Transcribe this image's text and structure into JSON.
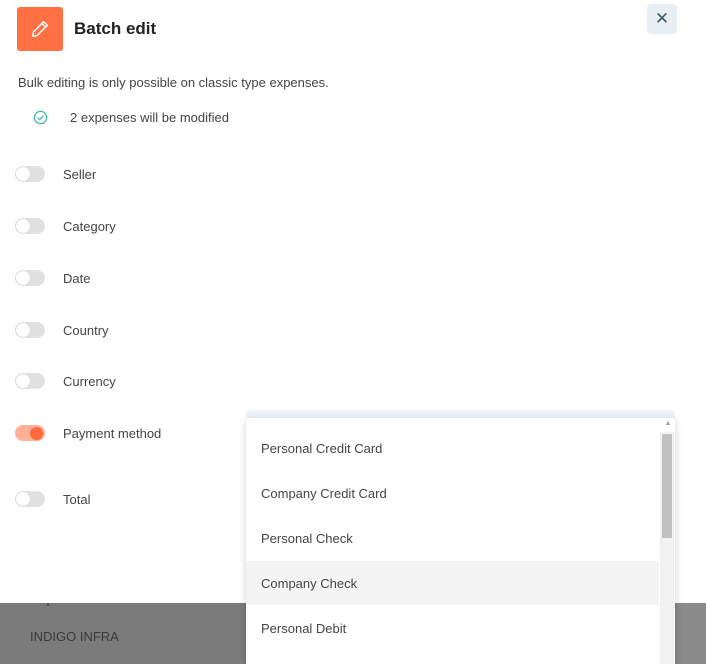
{
  "header": {
    "title": "Batch edit",
    "icon": "pencil-icon",
    "close_icon": "close-icon",
    "close_glyph": "✕"
  },
  "info": {
    "text": "Bulk editing is only possible on classic type expenses.",
    "modified_count_text": "2 expenses will be modified"
  },
  "fields": [
    {
      "label": "Seller",
      "enabled": false
    },
    {
      "label": "Category",
      "enabled": false
    },
    {
      "label": "Date",
      "enabled": false
    },
    {
      "label": "Country",
      "enabled": false
    },
    {
      "label": "Currency",
      "enabled": false
    },
    {
      "label": "Payment method",
      "enabled": true
    },
    {
      "label": "Total",
      "enabled": false
    }
  ],
  "dropdown": {
    "options": [
      "Personal Credit Card",
      "Company Credit Card",
      "Personal Check",
      "Company Check",
      "Personal Debit"
    ],
    "highlighted": "Company Check"
  },
  "background": {
    "row_text": "INDIGO INFRA"
  },
  "colors": {
    "accent": "#ff7043",
    "toggle_on": "#ff6a3d",
    "success": "#3ab7a5"
  }
}
